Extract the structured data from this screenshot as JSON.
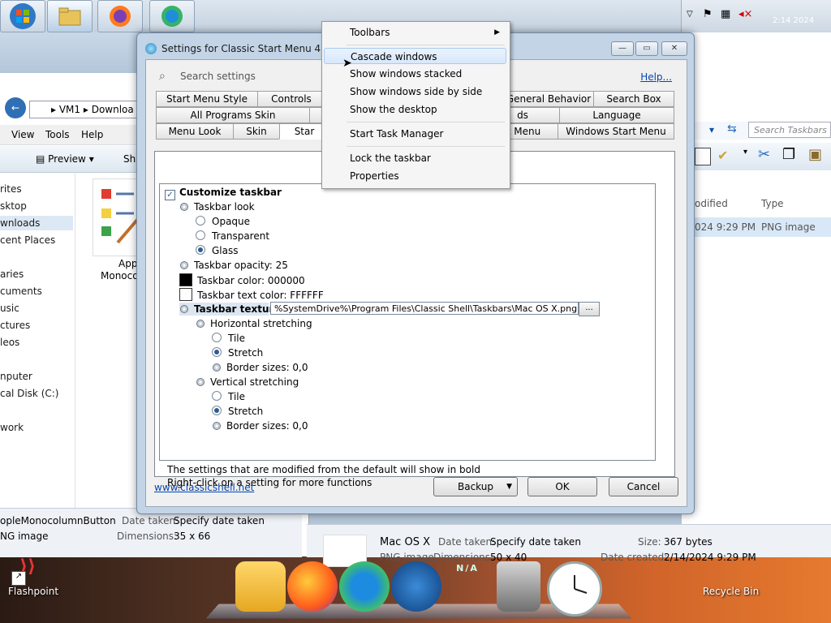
{
  "taskbar_top": {
    "buttons": [
      "start-orb",
      "file-explorer",
      "firefox",
      "edge"
    ],
    "tray": {
      "time_fragment": "2:14 2024"
    }
  },
  "explorer": {
    "address": [
      "VM1",
      "Downloa"
    ],
    "menus": [
      "View",
      "Tools",
      "Help"
    ],
    "toolbar_preview": "Preview",
    "toolbar_share": "Sha",
    "nav_items": [
      "rites",
      "sktop",
      "wnloads",
      "cent Places",
      "aries",
      "cuments",
      "usic",
      "ctures",
      "leos",
      "nputer",
      "cal Disk (C:)",
      "work"
    ],
    "file_name_fragment": "App",
    "file_name_fragment2": "Monoco",
    "details_left": {
      "name": "opleMonocolumnButton",
      "type": "NG image",
      "date_label": "Date taken:",
      "date_value": "Specify date taken",
      "dims_label": "Dimensions:",
      "dims_value": "35 x 66"
    },
    "right_pane": {
      "search_placeholder": "Search Taskbars",
      "col_modified": "odified",
      "col_type": "Type",
      "row_modified": "024 9:29 PM",
      "row_type": "PNG image"
    },
    "details_mid": {
      "name": "Mac OS X",
      "type": "PNG image",
      "date_label": "Date taken:",
      "date_value": "Specify date taken",
      "dims_label": "Dimensions:",
      "dims_value": "50 x 40",
      "size_label": "Size:",
      "size_value": "367 bytes",
      "created_label": "Date created:",
      "created_value": "2/14/2024 9:29 PM"
    }
  },
  "dialog": {
    "title": "Settings for Classic Start Menu 4.3.1",
    "search_placeholder": "Search settings",
    "help_link": "Help...",
    "tabs_row1": [
      "Start Menu Style",
      "Controls",
      "General Behavior",
      "Search Box"
    ],
    "tabs_row2": [
      "All Programs Skin",
      "ds",
      "Language"
    ],
    "tabs_row3": [
      "Menu Look",
      "Skin",
      "Star",
      "rt Menu",
      "Windows Start Menu"
    ],
    "tree": {
      "customize_taskbar": "Customize taskbar",
      "taskbar_look": "Taskbar look",
      "opaque": "Opaque",
      "transparent": "Transparent",
      "glass": "Glass",
      "opacity": "Taskbar opacity: 25",
      "color": "Taskbar color: 000000",
      "text_color": "Taskbar text color: FFFFFF",
      "texture": "Taskbar texture",
      "texture_path": "%SystemDrive%\\Program Files\\Classic Shell\\Taskbars\\Mac OS X.png",
      "browse": "...",
      "h_stretch": "Horizontal stretching",
      "tile": "Tile",
      "stretch": "Stretch",
      "border_sizes": "Border sizes: 0,0",
      "v_stretch": "Vertical stretching"
    },
    "note1": "The settings that are modified from the default will show in bold",
    "note2": "Right-click on a setting for more functions",
    "site_link": "www.classicshell.net",
    "backup": "Backup",
    "ok": "OK",
    "cancel": "Cancel",
    "caption": {
      "minimize": "—",
      "maximize": "▭",
      "close": "✕"
    }
  },
  "context_menu": {
    "toolbars": "Toolbars",
    "cascade": "Cascade windows",
    "stacked": "Show windows stacked",
    "side_by_side": "Show windows side by side",
    "show_desktop": "Show the desktop",
    "task_manager": "Start Task Manager",
    "lock": "Lock the taskbar",
    "properties": "Properties"
  },
  "desktop": {
    "flashpoint": "Flashpoint",
    "recycle_bin": "Recycle Bin",
    "dock_na": "N/A"
  }
}
